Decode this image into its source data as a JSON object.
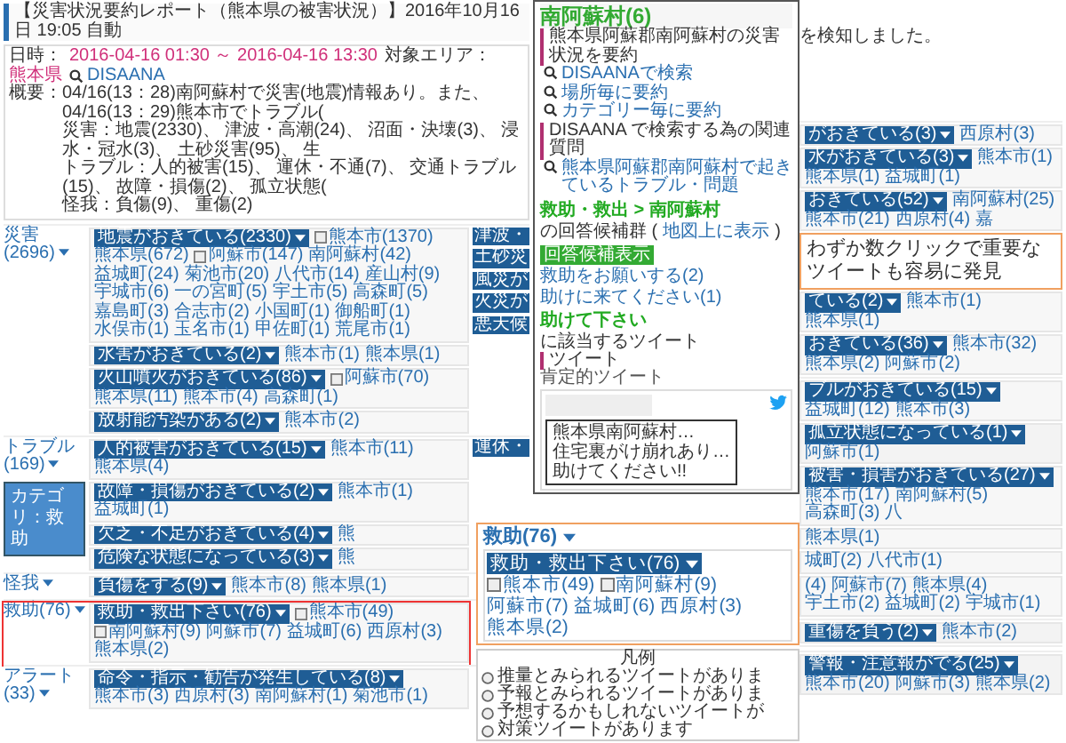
{
  "header": {
    "title": "【災害状況要約レポート（熊本県の被害状況）】2016年10月16日 19:05 自動",
    "date_label": "日時：",
    "range": "2016-04-16 01:30 ～ 2016-04-16 13:30",
    "area_label": "対象エリア：",
    "area": "熊本県",
    "search_link": "DISAANA",
    "summary_label": "概要：",
    "summary_lines": [
      "04/16(13：28)南阿蘇村で災害(地震)情報あり。また、04/16(13：29)熊本市でトラブル(",
      "災害：地震(2330)、 津波・高潮(24)、 沼面・決壊(3)、 浸水・冠水(3)、 土砂災害(95)、 生",
      "トラブル：人的被害(15)、 運休・不通(7)、 交通トラブル(15)、 故障・損傷(2)、 孤立状態(",
      "怪我：負傷(9)、 重傷(2)"
    ],
    "summary_tail": "を検知しました。"
  },
  "categories": [
    {
      "label": "災害(2696)",
      "highlighted": false,
      "left": [
        {
          "tag": "地震がおきている(2330)",
          "links": [
            {
              "text": "熊本市(1370)",
              "marked": true
            },
            {
              "text": "熊本県(672)",
              "marked": false
            },
            {
              "text": "阿蘇市(147)",
              "marked": true
            },
            {
              "text": "南阿蘇村(42)",
              "marked": false
            },
            {
              "text": "益城町(24)",
              "marked": false
            },
            {
              "text": "菊池市(20)",
              "marked": false
            },
            {
              "text": "八代市(14)",
              "marked": false
            },
            {
              "text": "産山村(9)",
              "marked": false
            },
            {
              "text": "宇城市(6)",
              "marked": false
            },
            {
              "text": "一の宮町(5)",
              "marked": false
            },
            {
              "text": "宇土市(5)",
              "marked": false
            },
            {
              "text": "高森町(5)",
              "marked": false
            },
            {
              "text": "嘉島町(3)",
              "marked": false
            },
            {
              "text": "合志市(2)",
              "marked": false
            },
            {
              "text": "小国町(1)",
              "marked": false
            },
            {
              "text": "御船町(1)",
              "marked": false
            },
            {
              "text": "水俣市(1)",
              "marked": false
            },
            {
              "text": "玉名市(1)",
              "marked": false
            },
            {
              "text": "甲佐町(1)",
              "marked": false
            },
            {
              "text": "荒尾市(1)",
              "marked": false
            }
          ]
        },
        {
          "tag": "水害がおきている(2)",
          "links": [
            {
              "text": "熊本市(1)",
              "marked": false
            },
            {
              "text": "熊本県(1)",
              "marked": false
            }
          ]
        },
        {
          "tag": "火山噴火がおきている(86)",
          "links": [
            {
              "text": "阿蘇市(70)",
              "marked": true
            },
            {
              "text": "熊本県(11)",
              "marked": false
            },
            {
              "text": "熊本市(4)",
              "marked": false
            },
            {
              "text": "高森町(1)",
              "marked": false
            }
          ]
        },
        {
          "tag": "放射能汚染がある(2)",
          "links": [
            {
              "text": "熊本市(2)",
              "marked": false
            }
          ]
        }
      ],
      "right": [
        {
          "kind": "split",
          "fragment": "津波・",
          "tag": "がおきている(3)",
          "links": [
            "西原村(3)"
          ]
        },
        {
          "kind": "split",
          "fragment": "土砂災",
          "tag": "水がおきている(3)",
          "links": [
            "熊本市(1)",
            "熊本県(1)",
            "益城町(1)"
          ]
        },
        {
          "kind": "split",
          "fragment": "風災が",
          "tag": "おきている(52)",
          "links": [
            "南阿蘇村(25)",
            "熊本市(21)",
            "西原村(4)",
            "嘉"
          ]
        },
        {
          "kind": "fragment",
          "fragment": "火災が"
        },
        {
          "kind": "tail",
          "tag": "ている(2)",
          "links": [
            "熊本市(1)",
            "熊本県(1)"
          ]
        },
        {
          "kind": "split",
          "fragment": "悪天候",
          "tag": "おきている(36)",
          "links": [
            "熊本市(32)",
            "熊本県(2)",
            "阿蘇市(2)"
          ]
        }
      ]
    },
    {
      "label": "トラブル(169)",
      "highlighted": false,
      "left": [
        {
          "tag": "人的被害がおきている(15)",
          "links": [
            {
              "text": "熊本市(11)",
              "marked": false
            },
            {
              "text": "熊本県(4)",
              "marked": false
            }
          ]
        },
        {
          "tag": "故障・損傷がおきている(2)",
          "links": [
            {
              "text": "熊本市(1)",
              "marked": false
            },
            {
              "text": "益城町(1)",
              "marked": false
            }
          ]
        },
        {
          "tag": "欠乏・不足がおきている(4)",
          "links": [
            {
              "text": "熊",
              "marked": false
            }
          ]
        },
        {
          "tag": "危険な状態になっている(3)",
          "links": [
            {
              "text": "熊",
              "marked": false
            }
          ]
        }
      ],
      "right": [
        {
          "kind": "split",
          "fragment": "運休・",
          "tag": "ブルがおきている(15)",
          "links": [
            "益城町(12)",
            "熊本市(3)"
          ]
        },
        {
          "kind": "full",
          "tag": "孤立状態になっている(1)",
          "links": [
            "阿蘇市(1)"
          ]
        },
        {
          "kind": "tail",
          "tag": "被害・損害がおきている(27)",
          "links": [
            "熊本市(17)",
            "南阿蘇村(5)",
            "高森町(3)",
            "八"
          ]
        },
        {
          "kind": "tail",
          "links": [
            "熊本県(1)"
          ]
        },
        {
          "kind": "tail",
          "links": [
            "城町(2)",
            "八代市(1)"
          ]
        },
        {
          "kind": "tail",
          "links": [
            "(4)",
            "阿蘇市(7)",
            "熊本県(4)",
            "宇土市(2)",
            "益城町(2)",
            "宇城市(1)"
          ]
        }
      ]
    },
    {
      "label": "怪我",
      "highlighted": false,
      "left": [
        {
          "tag": "負傷をする(9)",
          "links": [
            {
              "text": "熊本市(8)",
              "marked": false
            },
            {
              "text": "熊本県(1)",
              "marked": false
            }
          ]
        }
      ],
      "right": [
        {
          "kind": "full",
          "tag": "重傷を負う(2)",
          "links": [
            "熊本市(2)"
          ]
        }
      ]
    },
    {
      "label": "救助(76)",
      "highlighted": true,
      "left": [
        {
          "tag": "救助・救出下さい(76)",
          "links": [
            {
              "text": "熊本市(49)",
              "marked": true
            },
            {
              "text": "南阿蘇村(9)",
              "marked": true
            },
            {
              "text": "阿蘇市(7)",
              "marked": false
            },
            {
              "text": "益城町(6)",
              "marked": false
            },
            {
              "text": "西原村(3)",
              "marked": false
            },
            {
              "text": "熊本県(2)",
              "marked": false
            }
          ]
        }
      ]
    },
    {
      "label": "アラート(33)",
      "highlighted": false,
      "left": [
        {
          "tag": "命令・指示・勧告が発生している(8)",
          "links": [
            {
              "text": "熊本市(3)",
              "marked": false
            },
            {
              "text": "西原村(3)",
              "marked": false
            },
            {
              "text": "南阿蘇村(1)",
              "marked": false
            },
            {
              "text": "菊池市(1)",
              "marked": false
            }
          ]
        }
      ],
      "right": [
        {
          "kind": "full",
          "tag": "警報・注意報がでる(25)",
          "links": [
            "熊本市(20)",
            "阿蘇市(3)",
            "熊本県(2)"
          ]
        }
      ]
    }
  ],
  "popup": {
    "title": "南阿蘇村(6)",
    "section_1": "熊本県阿蘇郡南阿蘇村の災害状況を要約",
    "links_1": [
      "DISAANAで検索",
      "場所毎に要約",
      "カテゴリー毎に要約"
    ],
    "section_2": "DISAANA で検索する為の関連質問",
    "links_2": [
      "熊本県阿蘇郡南阿蘇村で起きているトラブル・問題"
    ],
    "answer_title": "救助・救出 > 南阿蘇村",
    "answer_suffix": "の回答候補群 (",
    "map_link": "地図上に表示",
    "answer_close": ")",
    "answer_badge": "回答候補表示",
    "answer_links": [
      "救助をお願いする(2)",
      "助けに来てください(1)"
    ],
    "tweet_title": "助けて下さい",
    "tweet_suffix": "に該当するツイート",
    "section_3": "ツイート",
    "positive_label": "肯定的ツイート",
    "tweet_note": [
      "熊本県南阿蘇村…",
      "住宅裏がけ崩れあり…",
      "助けてください!!"
    ]
  },
  "callout": [
    "わずか数クリックで重要な",
    "ツイートも容易に発見"
  ],
  "zoom": {
    "label": "救助(76)",
    "tag": "救助・救出下さい(76)",
    "links": [
      {
        "text": "熊本市(49)",
        "marked": true
      },
      {
        "text": "南阿蘇村(9)",
        "marked": true
      },
      {
        "text": "阿蘇市(7)",
        "marked": false
      },
      {
        "text": "益城町(6)",
        "marked": false
      },
      {
        "text": "西原村(3)",
        "marked": false
      },
      {
        "text": "熊本県(2)",
        "marked": false
      }
    ]
  },
  "category_note": "カテゴリ：救助",
  "legend": {
    "title": "凡例",
    "items": [
      "推量とみられるツイートがありま",
      "予報とみられるツイートがありま",
      "予想するかもしれないツイートが",
      "対策ツイートがあります"
    ]
  }
}
